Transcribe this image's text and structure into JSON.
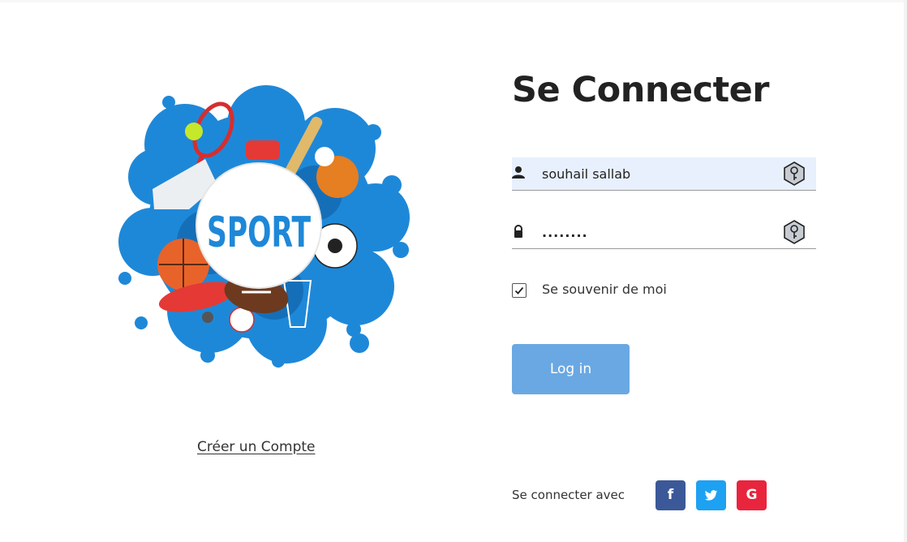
{
  "login": {
    "title": "Se Connecter",
    "username_value": "souhail sallab",
    "password_value": "........",
    "remember_label": "Se souvenir de moi",
    "remember_checked": true,
    "login_button": "Log in",
    "social_label": "Se connecter avec",
    "social": [
      {
        "name": "facebook",
        "icon": "facebook-icon",
        "glyph": "f",
        "color": "#3b5998"
      },
      {
        "name": "twitter",
        "icon": "twitter-icon",
        "glyph": "",
        "color": "#1da1f2"
      },
      {
        "name": "google",
        "icon": "google-icon",
        "glyph": "G",
        "color": "#e8253d"
      }
    ]
  },
  "left": {
    "logo_text": "SPORT",
    "create_account": "Créer un Compte"
  },
  "colors": {
    "accent": "#6aa8e3",
    "autofill_bg": "#e8f0fe",
    "logo_blue": "#1e88d8"
  }
}
